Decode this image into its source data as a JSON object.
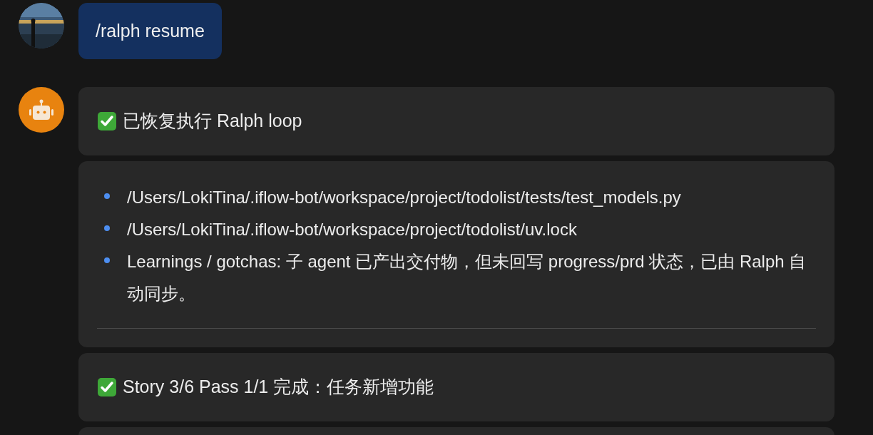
{
  "user_message": {
    "text": "/ralph resume"
  },
  "bot_messages": [
    {
      "kind": "status",
      "text": "已恢复执行 Ralph loop"
    },
    {
      "kind": "list",
      "items": [
        "/Users/LokiTina/.iflow-bot/workspace/project/todolist/tests/test_models.py",
        "/Users/LokiTina/.iflow-bot/workspace/project/todolist/uv.lock",
        "Learnings / gotchas: 子 agent 已产出交付物，但未回写 progress/prd 状态，已由 Ralph 自动同步。"
      ]
    },
    {
      "kind": "status",
      "text": "Story 3/6 Pass 1/1 完成：任务新增功能"
    },
    {
      "kind": "partial"
    }
  ]
}
